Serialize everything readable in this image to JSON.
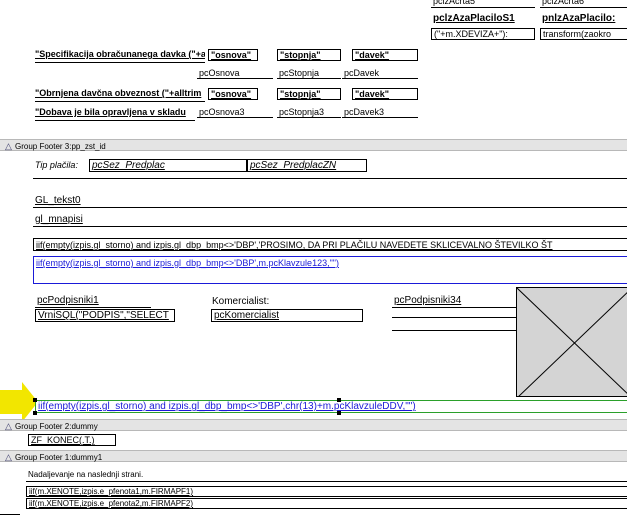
{
  "top_fields": {
    "c1r1": "pclzAcrta5",
    "c2r1": "pclzAcrta6",
    "c1r2": "pclzAzaPlaciloS1",
    "c2r2": "pnlzAzaPlacilo:",
    "c1r3": "(\"+m.XDEVIZA+\"):",
    "c2r3": "transform(zaokro"
  },
  "detail": {
    "spec_label": "\"Specifikacija obračunanega davka (\"+alltrim(",
    "spec_overlap": "\"osnova\"",
    "stopnja1": "\"stopnja\"",
    "davek1": "\"davek\"",
    "pcOsnova": "pcOsnova",
    "pcStopnja": "pcStopnja",
    "pcDavek": "pcDavek",
    "obrnjena_label": "\"Obrnjena davčna obveznost (\"+alltrim",
    "obrnjena_overlap": "\"osnova\"",
    "stopnja2": "\"stopnja\"",
    "davek2": "\"davek\"",
    "dobava_label": "\"Dobava je bila opravljena v skladu",
    "pcOsnova3": "pcOsnova3",
    "pcStopnja3": "pcStopnja3",
    "pcDavek3": "pcDavek3"
  },
  "band3": {
    "title": "Group Footer 3:pp_zst_id",
    "tip_label": "Tip plačila:",
    "pcSez_Predplac": "pcSez_Predplac",
    "pcSez_PredplacZN": "pcSez_PredplacZN",
    "gl_tekst0": "GL_tekst0",
    "gl_mnapisi": "gl_mnapisi",
    "iif1": "iif(empty(izpis.gl_storno) and izpis.gl_dbp_bmp<>'DBP','PROSIMO, DA PRI PLAČILU NAVEDETE SKLICEVALNO ŠTEVILKO ŠT",
    "iif2": "iif(empty(izpis.gl_storno) and izpis.gl_dbp_bmp<>'DBP',m.pcKlavzule123,\"\")",
    "pcPodpisniki1": "pcPodpisniki1",
    "vrnisql": "VrniSQL(\"PODPIS\",\"SELECT",
    "komercialist_label": "Komercialist:",
    "pcKomercialist": "pcKomercialist",
    "pcPodpisniki34": "pcPodpisniki34",
    "iif3": "iif(empty(izpis.gl_storno) and izpis.gl_dbp_bmp<>'DBP',chr(13)+m.pcKlavzuleDDV,\"\")"
  },
  "band2": {
    "title": "Group Footer 2:dummy",
    "zf_konec": "ZF_KONEC(.T.)"
  },
  "band1": {
    "title": "Group Footer 1:dummy1",
    "nadaljevanje": "Nadaljevanje na naslednji strani.",
    "iif_xenote1": "iif(m.XENOTE,izpis.e_pfenota1,m.FIRMAPF1)",
    "iif_xenote2": "iif(m.XENOTE,izpis.e_pfenota2,m.FIRMAPF2)"
  },
  "colors": {
    "band_bg": "#e4e4e4",
    "blue_text": "#1a1ad8",
    "selection_green": "#2aa02a",
    "arrow_yellow": "#f2e600",
    "picture_gray": "#d4d4d4"
  },
  "icons": {
    "band_toggle": "triangle-up-icon",
    "picture_placeholder": "image-placeholder-icon",
    "pointer": "yellow-arrow-icon"
  }
}
